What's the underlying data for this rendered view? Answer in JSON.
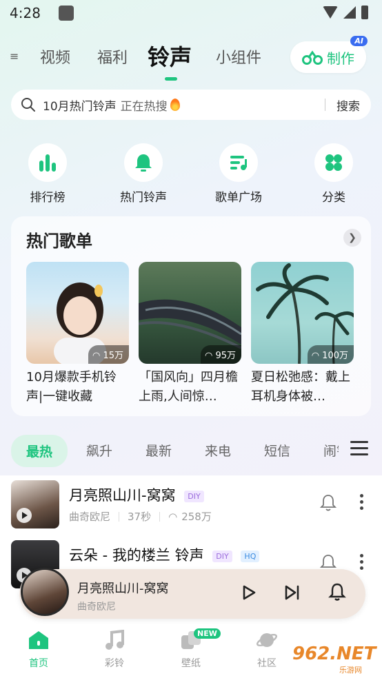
{
  "status": {
    "time": "4:28"
  },
  "topnav": {
    "more": "≡",
    "tabs": [
      "视频",
      "福利",
      "铃声",
      "小组件"
    ],
    "active_tab": "铃声",
    "make_label": "制作",
    "ai_badge": "AI"
  },
  "search": {
    "text": "10月热门铃声",
    "hot": "正在热搜",
    "button": "搜索"
  },
  "quick_actions": [
    {
      "label": "排行榜",
      "icon": "chart-bars-icon"
    },
    {
      "label": "热门铃声",
      "icon": "bell-icon"
    },
    {
      "label": "歌单广场",
      "icon": "playlist-icon"
    },
    {
      "label": "分类",
      "icon": "grid-icon"
    }
  ],
  "hot_playlists": {
    "title": "热门歌单",
    "items": [
      {
        "title": "10月爆款手机铃声|一键收藏",
        "plays": "15万"
      },
      {
        "title": "「国风向」四月檐上雨,人间惊…",
        "plays": "95万"
      },
      {
        "title": "夏日松弛感：戴上耳机身体被…",
        "plays": "100万"
      }
    ]
  },
  "category_tabs": [
    "最热",
    "飙升",
    "最新",
    "来电",
    "短信",
    "闹钟"
  ],
  "songs": [
    {
      "title": "月亮照山川-窝窝",
      "tags": [
        "DIY"
      ],
      "artist": "曲奇欧尼",
      "duration": "37秒",
      "plays": "258万"
    },
    {
      "title": "云朵 - 我的楼兰 铃声",
      "tags": [
        "DIY",
        "HQ"
      ],
      "artist": "",
      "duration": "",
      "plays": ""
    }
  ],
  "player": {
    "title": "月亮照山川-窝窝",
    "artist": "曲奇欧尼"
  },
  "bottomnav": {
    "items": [
      {
        "label": "首页",
        "icon": "home-icon",
        "active": true
      },
      {
        "label": "彩铃",
        "icon": "music-note-icon",
        "active": false
      },
      {
        "label": "壁纸",
        "icon": "wallpaper-icon",
        "active": false,
        "badge": "NEW"
      },
      {
        "label": "社区",
        "icon": "planet-icon",
        "active": false
      }
    ]
  },
  "watermark": {
    "text": "962.NET",
    "sub": "乐游网"
  },
  "colors": {
    "accent": "#1ec47f",
    "ai_badge": "#3a6cf0",
    "player_bg": "#f1e6df"
  }
}
